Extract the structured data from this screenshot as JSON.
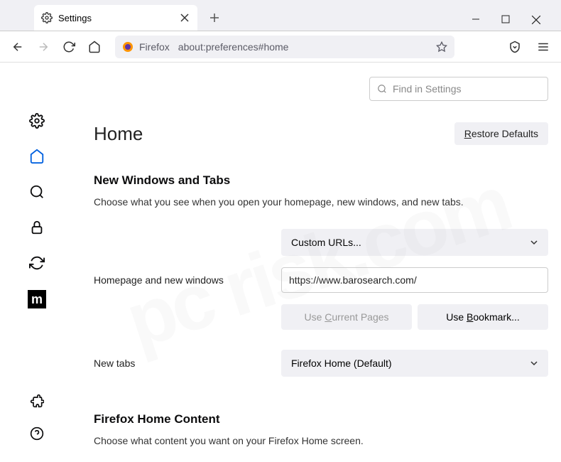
{
  "tab": {
    "title": "Settings"
  },
  "urlbar": {
    "prefix": "Firefox",
    "url": "about:preferences#home"
  },
  "search": {
    "placeholder": "Find in Settings"
  },
  "page": {
    "title": "Home",
    "restore": "Restore Defaults"
  },
  "section1": {
    "heading": "New Windows and Tabs",
    "desc": "Choose what you see when you open your homepage, new windows, and new tabs."
  },
  "homepage": {
    "label": "Homepage and new windows",
    "dropdown": "Custom URLs...",
    "url": "https://www.barosearch.com/",
    "btn_current": "Use Current Pages",
    "btn_bookmark": "Use Bookmark..."
  },
  "newtabs": {
    "label": "New tabs",
    "dropdown": "Firefox Home (Default)"
  },
  "section2": {
    "heading": "Firefox Home Content",
    "desc": "Choose what content you want on your Firefox Home screen."
  }
}
